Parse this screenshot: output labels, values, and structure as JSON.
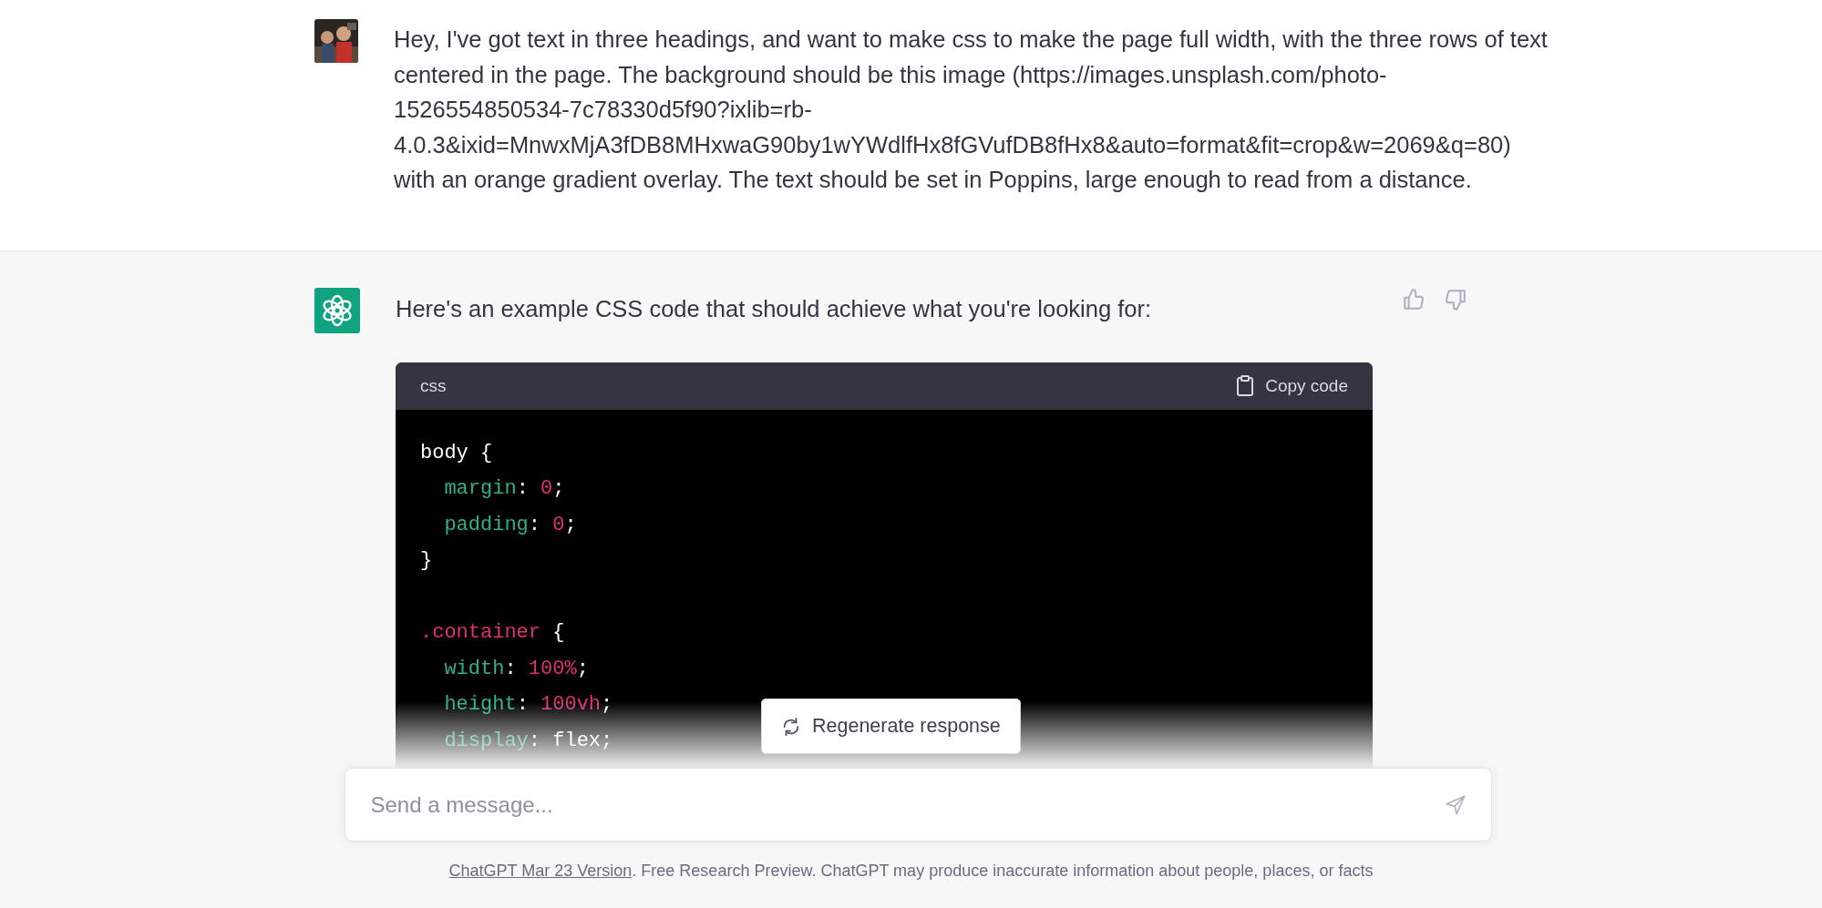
{
  "conversation": [
    {
      "kind": "user",
      "text": "Hey, I've got text in three headings, and want to make css to make the page full width, with the three rows of text centered in the page. The background should be this image (https://images.unsplash.com/photo-1526554850534-7c78330d5f90?ixlib=rb-4.0.3&ixid=MnwxMjA3fDB8MHxwaG90by1wYWdlfHx8fGVufDB8fHx8&auto=format&fit=crop&w=2069&q=80) with an orange gradient overlay. The text should be set in Poppins, large enough to read from a distance."
    },
    {
      "kind": "assistant",
      "text": "Here's an example CSS code that should achieve what you're looking for:",
      "code_block": {
        "language": "css",
        "copy_label": "Copy code",
        "lines": [
          {
            "kind": "code",
            "tokens": [
              {
                "kind": "plain",
                "text": "body {"
              }
            ]
          },
          {
            "kind": "code",
            "tokens": [
              {
                "kind": "prop",
                "text": "  margin"
              },
              {
                "kind": "plain",
                "text": ": "
              },
              {
                "kind": "num",
                "text": "0"
              },
              {
                "kind": "plain",
                "text": ";"
              }
            ]
          },
          {
            "kind": "code",
            "tokens": [
              {
                "kind": "prop",
                "text": "  padding"
              },
              {
                "kind": "plain",
                "text": ": "
              },
              {
                "kind": "num",
                "text": "0"
              },
              {
                "kind": "plain",
                "text": ";"
              }
            ]
          },
          {
            "kind": "code",
            "tokens": [
              {
                "kind": "plain",
                "text": "}"
              }
            ]
          },
          {
            "kind": "blank"
          },
          {
            "kind": "code",
            "tokens": [
              {
                "kind": "sel",
                "text": ".container"
              },
              {
                "kind": "plain",
                "text": " {"
              }
            ]
          },
          {
            "kind": "code",
            "tokens": [
              {
                "kind": "prop",
                "text": "  width"
              },
              {
                "kind": "plain",
                "text": ": "
              },
              {
                "kind": "num",
                "text": "100%"
              },
              {
                "kind": "plain",
                "text": ";"
              }
            ]
          },
          {
            "kind": "code",
            "tokens": [
              {
                "kind": "prop",
                "text": "  height"
              },
              {
                "kind": "plain",
                "text": ": "
              },
              {
                "kind": "num",
                "text": "100vh"
              },
              {
                "kind": "plain",
                "text": ";"
              }
            ]
          },
          {
            "kind": "code",
            "tokens": [
              {
                "kind": "prop",
                "text": "  display"
              },
              {
                "kind": "plain",
                "text": ": "
              },
              {
                "kind": "plain",
                "text": "flex"
              },
              {
                "kind": "plain",
                "text": ";"
              }
            ]
          }
        ]
      }
    }
  ],
  "regenerate_button": "Regenerate response",
  "composer": {
    "placeholder": "Send a message..."
  },
  "footer": {
    "link": "ChatGPT Mar 23 Version",
    "text": ". Free Research Preview. ChatGPT may produce inaccurate information about people, places, or facts"
  }
}
